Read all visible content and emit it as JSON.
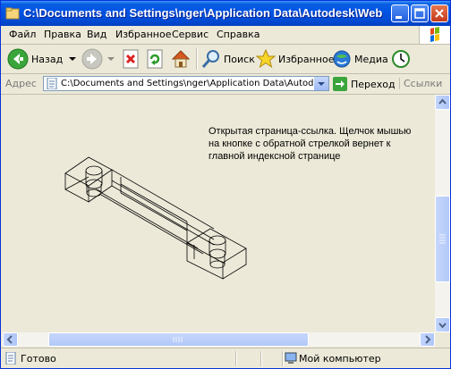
{
  "window": {
    "title": "C:\\Documents and Settings\\nger\\Application Data\\Autodesk\\Web Test P...",
    "buttons": [
      "minimize",
      "maximize",
      "close"
    ]
  },
  "menu": {
    "items": [
      "Файл",
      "Правка",
      "Вид",
      "Избранное",
      "Сервис",
      "Справка"
    ]
  },
  "toolbar": {
    "back_label": "Назад",
    "search_label": "Поиск",
    "favorites_label": "Избранное",
    "media_label": "Медиа"
  },
  "address": {
    "label": "Адрес",
    "value": "C:\\Documents and Settings\\nger\\Application Data\\Autodesk\\Web",
    "go_label": "Переход",
    "links_label": "Ссылки"
  },
  "content": {
    "text": "Открытая страница-ссылка. Щелчок мышью на кнопке с обратной стрелкой вернет к главной индексной странице"
  },
  "status": {
    "text": "Готово",
    "zone": "Мой компьютер"
  },
  "colors": {
    "titlebar": "#0055e5",
    "chrome": "#ece9d8",
    "scrollbar": "#b2c9f8"
  }
}
